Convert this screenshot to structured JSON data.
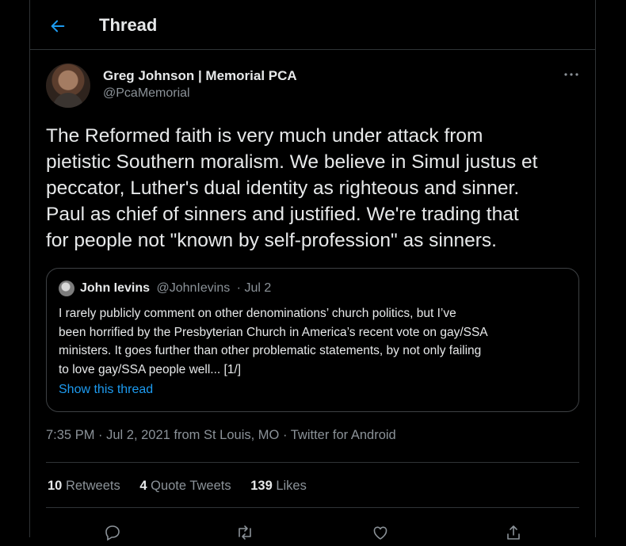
{
  "header": {
    "title": "Thread"
  },
  "tweet": {
    "author_name": "Greg Johnson | Memorial PCA",
    "author_handle": "@PcaMemorial",
    "text": "The Reformed faith is very much under attack from\npietistic Southern moralism. We believe in Simul justus et\npeccator, Luther's dual identity as righteous and sinner.\nPaul as chief of sinners and justified. We're trading that\nfor people not \"known by self-profession\" as sinners.",
    "timestamp": "7:35 PM · Jul 2, 2021 from St Louis, MO · Twitter for Android"
  },
  "quote": {
    "name": "John Ievins",
    "handle": "@JohnIevins",
    "date": "· Jul 2",
    "text": "I rarely publicly comment on other denominations’ church politics, but I’ve\nbeen horrified by the Presbyterian Church in America’s recent vote on gay/SSA\nministers. It goes further than other problematic statements, by not only failing\nto love gay/SSA people well... [1/]",
    "show_thread": "Show this thread"
  },
  "stats": {
    "retweets_count": "10",
    "retweets_label": "Retweets",
    "quotes_count": "4",
    "quotes_label": "Quote Tweets",
    "likes_count": "139",
    "likes_label": "Likes"
  },
  "icons": [
    "back-arrow-icon",
    "more-icon",
    "reply-icon",
    "retweet-icon",
    "like-icon",
    "share-icon"
  ],
  "colors": {
    "accent": "#1d9bf0",
    "background": "#000000",
    "muted": "#8b9298"
  }
}
